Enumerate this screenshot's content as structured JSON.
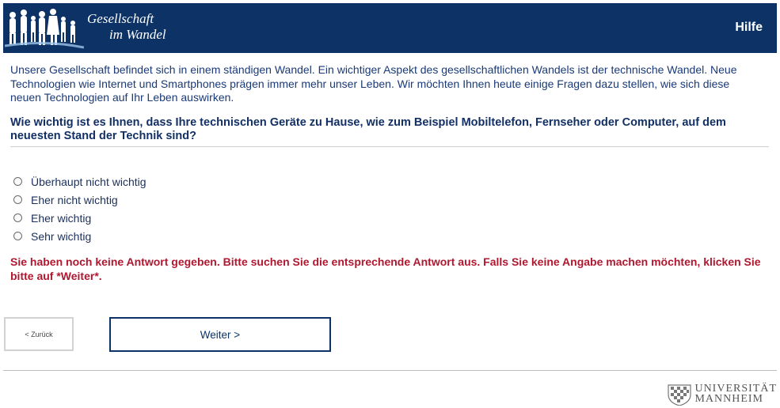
{
  "header": {
    "brand_line1": "Gesellschaft",
    "brand_line2": "im Wandel",
    "help_label": "Hilfe",
    "logo_icon": "people-silhouettes-icon"
  },
  "intro": "Unsere Gesellschaft befindet sich in einem ständigen Wandel. Ein wichtiger Aspekt des gesellschaftlichen Wandels ist der technische Wandel. Neue Technologien wie Internet und Smartphones prägen immer mehr unser Leben. Wir möchten Ihnen heute einige Fragen dazu stellen, wie sich diese neuen Technologien auf Ihr Leben auswirken.",
  "question": "Wie wichtig ist es Ihnen, dass Ihre technischen Geräte zu Hause, wie zum Beispiel Mobiltelefon, Fernseher oder Computer, auf dem neuesten Stand der Technik sind?",
  "options": [
    {
      "label": "Überhaupt nicht wichtig"
    },
    {
      "label": "Eher nicht wichtig"
    },
    {
      "label": "Eher wichtig"
    },
    {
      "label": "Sehr wichtig"
    }
  ],
  "error": "Sie haben noch keine Antwort gegeben. Bitte suchen Sie die entsprechende Antwort aus. Falls Sie keine Angabe machen möchten, klicken Sie bitte auf *Weiter*.",
  "nav": {
    "back_label": "< Zurück",
    "next_label": "Weiter >"
  },
  "footer": {
    "uni_line1": "UNIVERSITÄT",
    "uni_line2": "MANNHEIM",
    "crest_icon": "university-crest-icon"
  },
  "colors": {
    "header_bg": "#0d3366",
    "error_text": "#b01830"
  }
}
